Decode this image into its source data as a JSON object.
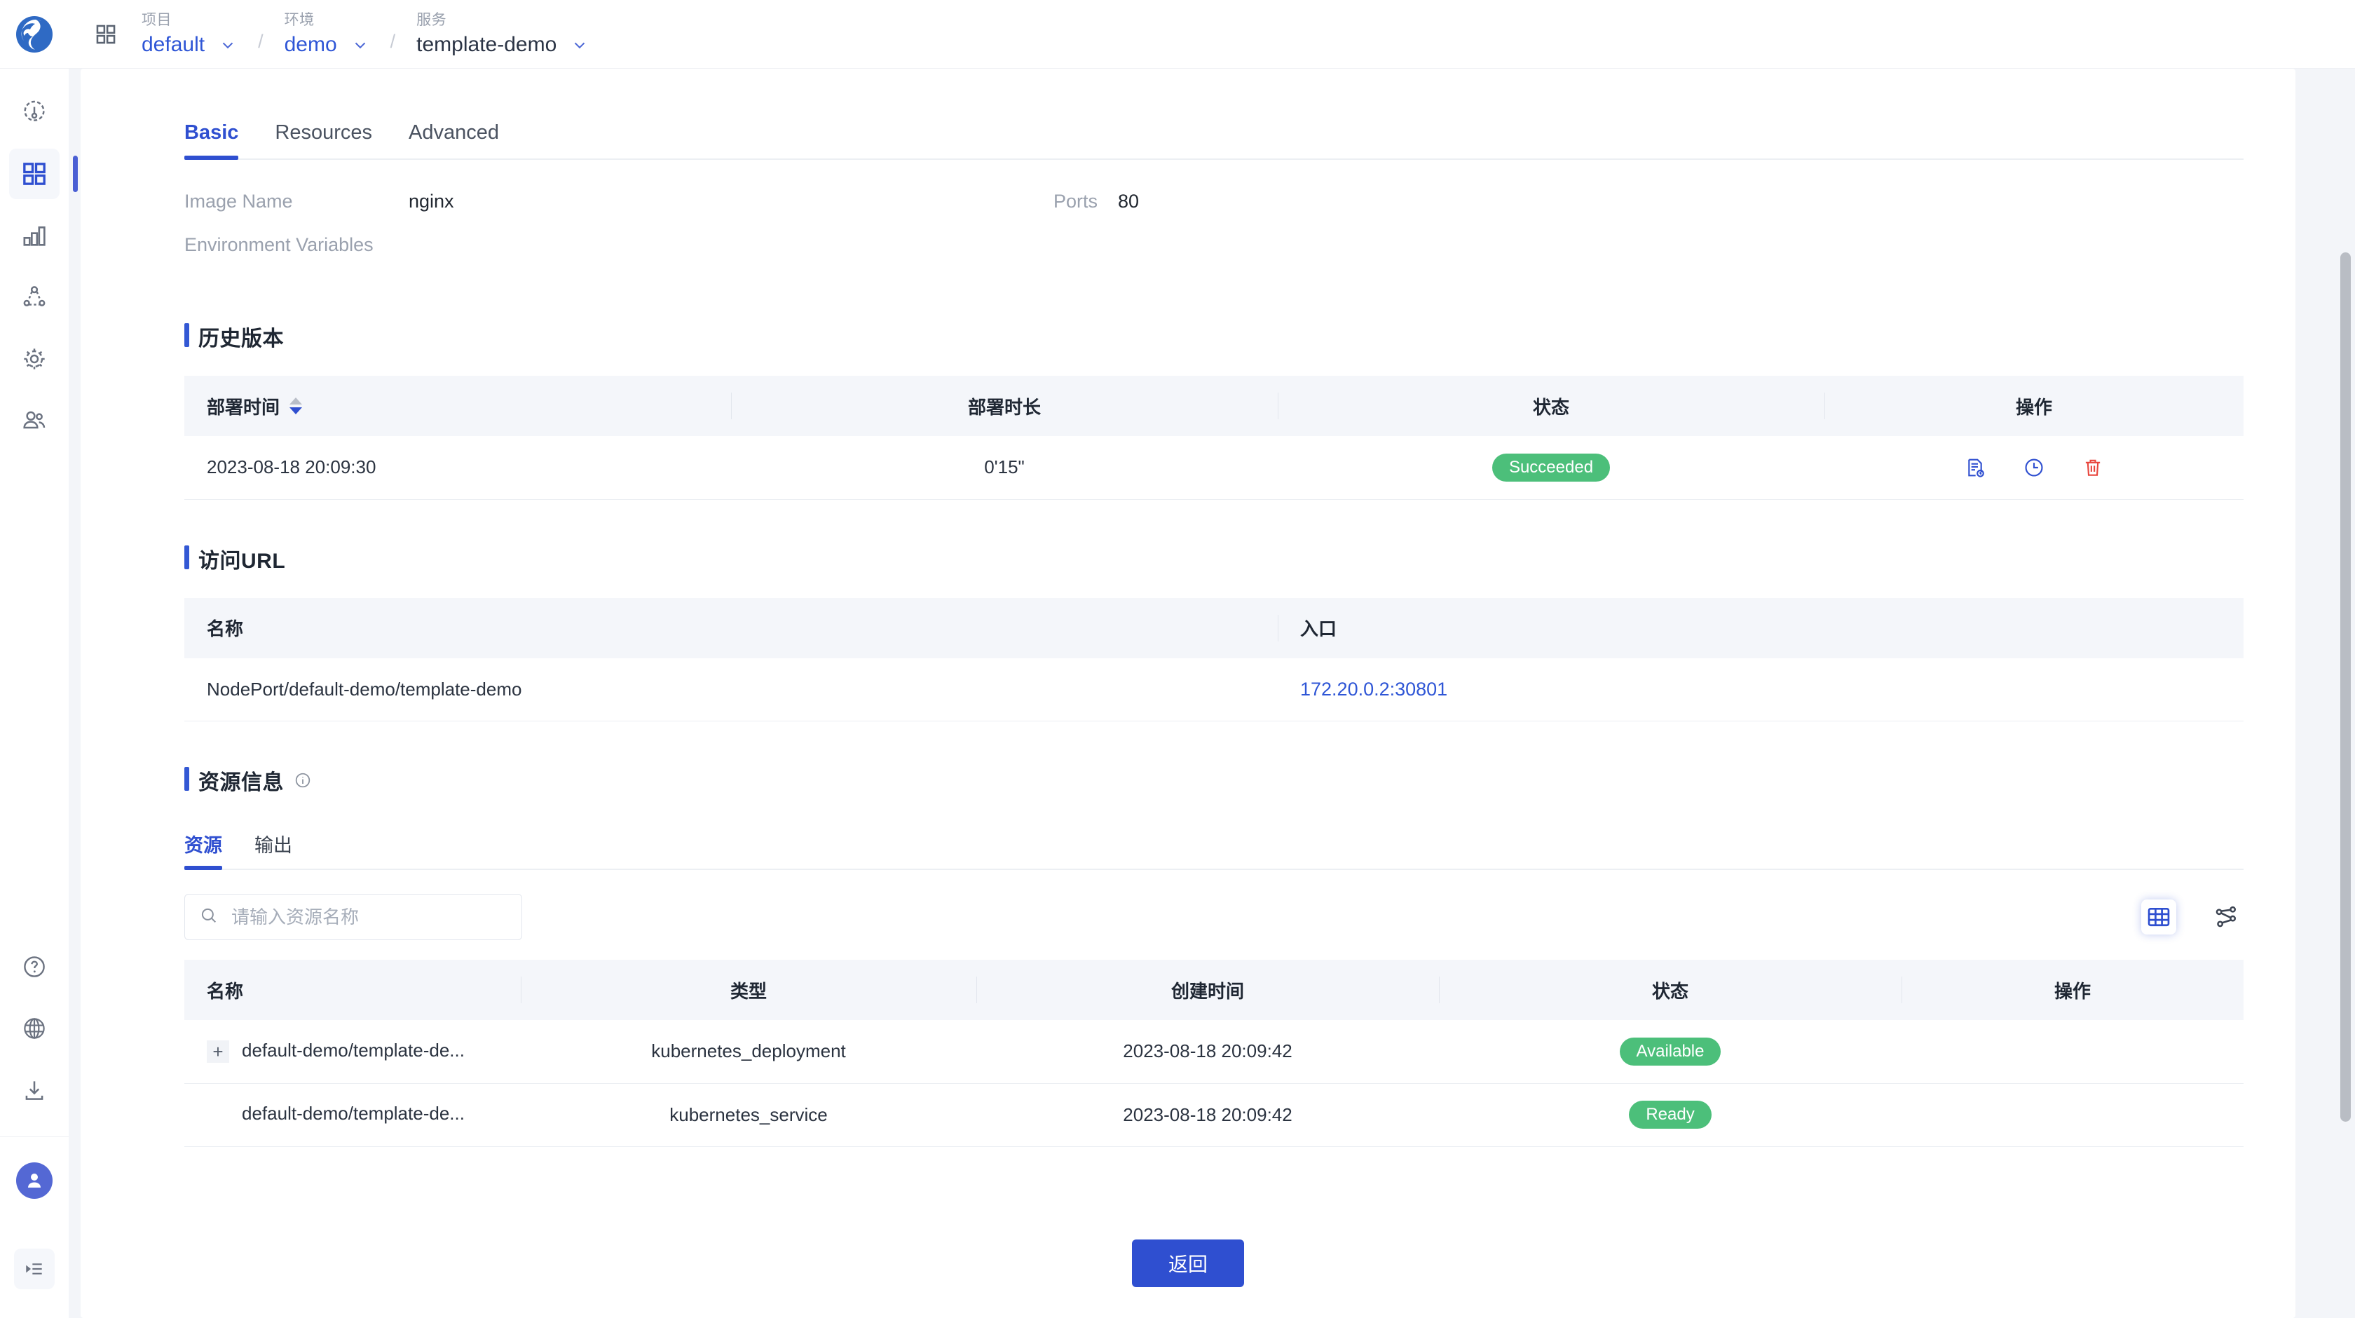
{
  "brand": {
    "logo_name": "kubevela-logo",
    "accent": "#2f4fd0",
    "link_color": "#2f56d6",
    "success_color": "#4cbf7a",
    "danger_color": "#e8453c"
  },
  "rail": {
    "items": [
      {
        "name": "dashboard-gauge-icon",
        "label": "Dashboard",
        "active": false
      },
      {
        "name": "applications-grid-icon",
        "label": "Applications",
        "active": true
      },
      {
        "name": "bar-chart-icon",
        "label": "Statistics",
        "active": false
      },
      {
        "name": "topology-icon",
        "label": "Topology",
        "active": false
      },
      {
        "name": "gear-icon",
        "label": "Settings",
        "active": false
      },
      {
        "name": "users-icon",
        "label": "Users",
        "active": false
      }
    ],
    "bottom": [
      {
        "name": "help-icon",
        "label": "Help"
      },
      {
        "name": "globe-icon",
        "label": "Language"
      },
      {
        "name": "download-icon",
        "label": "Download"
      }
    ],
    "avatar": "user-avatar",
    "collapse": "collapse-menu-icon"
  },
  "topbar": {
    "grid_icon": "app-switcher-icon",
    "breadcrumbs": [
      {
        "label": "项目",
        "value": "default",
        "has_chevron": true,
        "is_link": true
      },
      {
        "label": "环境",
        "value": "demo",
        "has_chevron": true,
        "is_link": true
      },
      {
        "label": "服务",
        "value": "template-demo",
        "has_chevron": true,
        "is_link": false
      }
    ],
    "separator": "/"
  },
  "tabs": [
    {
      "label": "Basic",
      "active": true
    },
    {
      "label": "Resources",
      "active": false
    },
    {
      "label": "Advanced",
      "active": false
    }
  ],
  "basic": {
    "image_name_label": "Image Name",
    "image_name_value": "nginx",
    "ports_label": "Ports",
    "ports_value": "80",
    "env_label": "Environment Variables",
    "env_value": ""
  },
  "history": {
    "title": "历史版本",
    "columns": [
      "部署时间",
      "部署时长",
      "状态",
      "操作"
    ],
    "sort_column": "部署时间",
    "sort_direction": "desc",
    "rows": [
      {
        "deploy_time": "2023-08-18 20:09:30",
        "duration": "0'15\"",
        "status": "Succeeded",
        "actions": [
          "view-log-icon",
          "history-clock-icon",
          "delete-trash-icon"
        ]
      }
    ]
  },
  "access_url": {
    "title": "访问URL",
    "columns": [
      "名称",
      "入口"
    ],
    "rows": [
      {
        "name": "NodePort/default-demo/template-demo",
        "entry": "172.20.0.2:30801"
      }
    ]
  },
  "resource_info": {
    "title": "资源信息",
    "info_icon": "info-circle-icon",
    "subtabs": [
      {
        "label": "资源",
        "active": true
      },
      {
        "label": "输出",
        "active": false
      }
    ],
    "search": {
      "placeholder": "请输入资源名称",
      "value": "",
      "icon": "search-icon"
    },
    "views": [
      {
        "name": "table-view-icon",
        "active": true
      },
      {
        "name": "graph-view-icon",
        "active": false
      }
    ],
    "columns": [
      "名称",
      "类型",
      "创建时间",
      "状态",
      "操作"
    ],
    "rows": [
      {
        "expandable": true,
        "expander": "+",
        "name": "default-demo/template-de...",
        "type": "kubernetes_deployment",
        "created": "2023-08-18 20:09:42",
        "status": "Available",
        "actions": ""
      },
      {
        "expandable": false,
        "expander": "",
        "name": "default-demo/template-de...",
        "type": "kubernetes_service",
        "created": "2023-08-18 20:09:42",
        "status": "Ready",
        "actions": ""
      }
    ]
  },
  "footer": {
    "back_label": "返回"
  }
}
